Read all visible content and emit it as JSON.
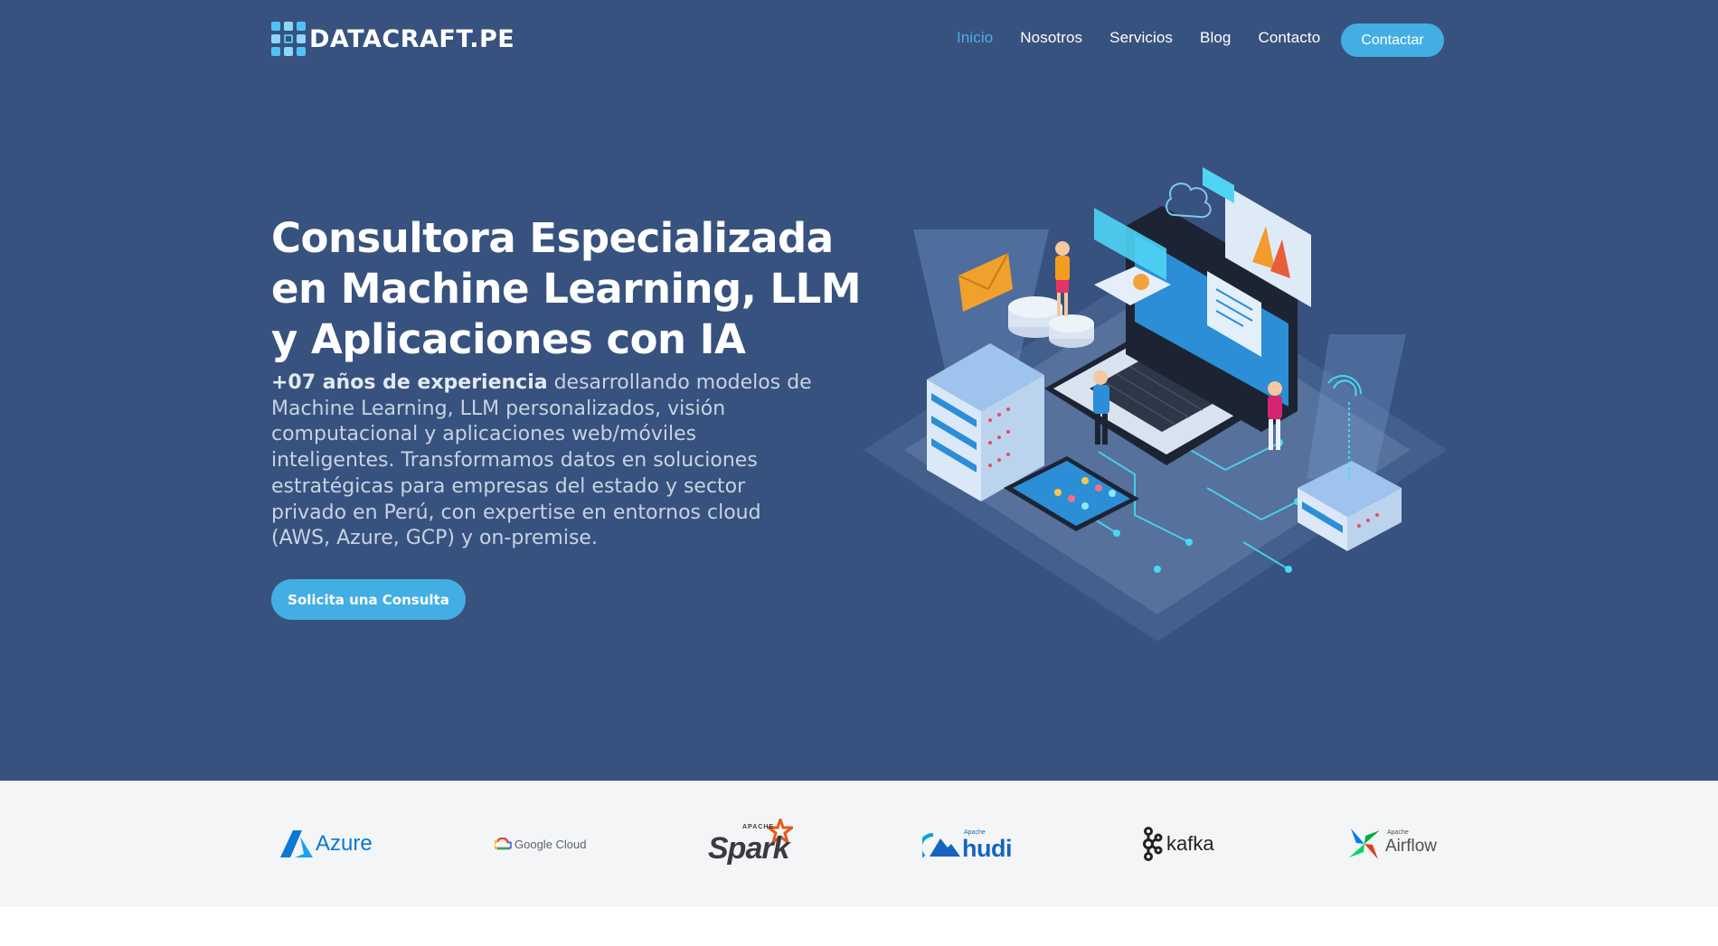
{
  "header": {
    "logo_text": "DATACRAFT",
    "logo_ext": ".PE",
    "nav": [
      {
        "label": "Inicio",
        "active": true
      },
      {
        "label": "Nosotros",
        "active": false
      },
      {
        "label": "Servicios",
        "active": false
      },
      {
        "label": "Blog",
        "active": false
      },
      {
        "label": "Contacto",
        "active": false
      }
    ],
    "cta_label": "Contactar"
  },
  "hero": {
    "title": "Consultora Especializada en Machine Learning, LLM y Aplicaciones con IA",
    "desc_bold": "+07 años de experiencia",
    "desc_rest": " desarrollando modelos de Machine Learning, LLM personalizados, visión computacional y aplicaciones web/móviles inteligentes. Transformamos datos en soluciones estratégicas para empresas del estado y sector privado en Perú, con expertise en entornos cloud (AWS, Azure, GCP) y on-premise.",
    "cta_label": "Solicita una Consulta",
    "illustration_icon": "isometric-data-platform-illustration"
  },
  "partners": {
    "azure": "Azure",
    "google_cloud": "Google Cloud",
    "spark_small": "APACHE",
    "spark": "Spark",
    "hudi_small": "Apache",
    "hudi": "hudi",
    "kafka": "kafka",
    "airflow_small": "Apache",
    "airflow": "Airflow"
  },
  "colors": {
    "hero_bg": "#37527e",
    "accent": "#43aee3",
    "logos_bg": "#f4f5f7"
  }
}
